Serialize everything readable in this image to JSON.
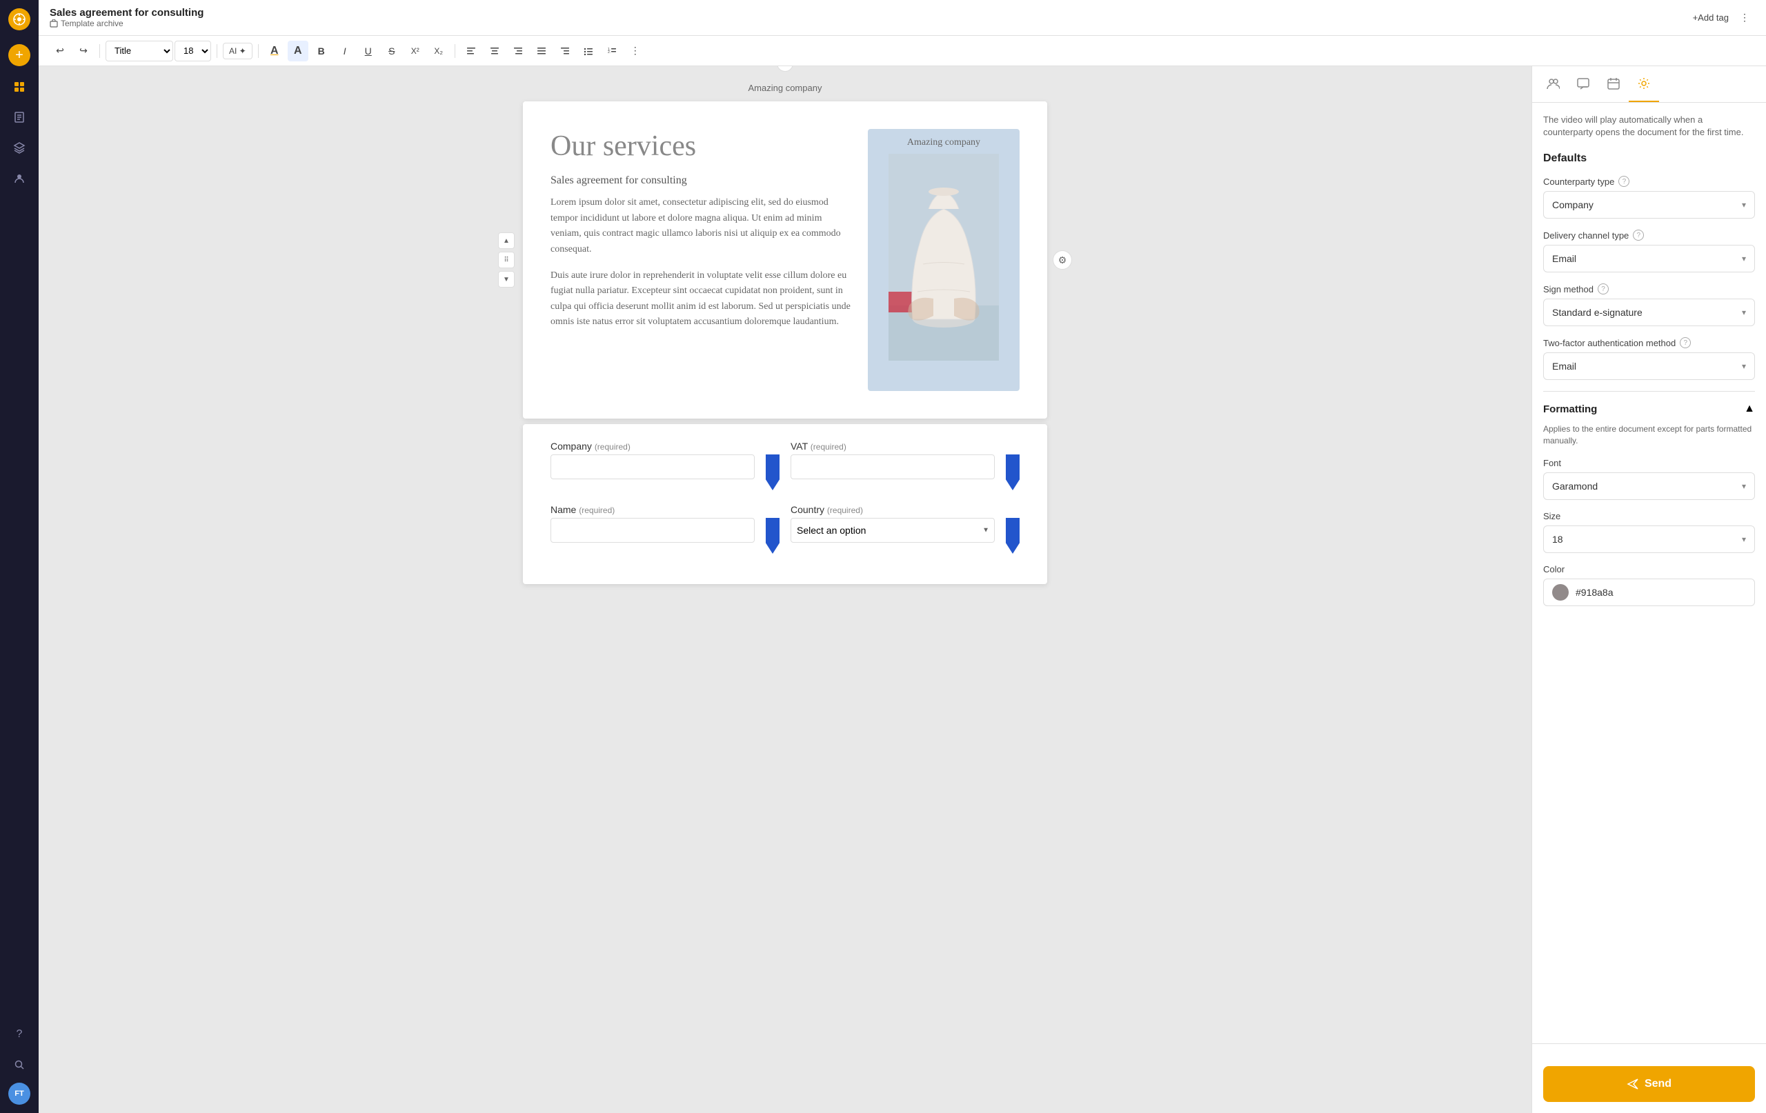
{
  "app": {
    "logo": "⊕",
    "avatar": "FT"
  },
  "sidebar": {
    "items": [
      {
        "name": "settings-icon",
        "icon": "⚙",
        "active": false
      },
      {
        "name": "grid-icon",
        "icon": "⊞",
        "active": false
      },
      {
        "name": "layers-icon",
        "icon": "≡",
        "active": false
      },
      {
        "name": "user-icon",
        "icon": "👤",
        "active": false
      }
    ]
  },
  "topbar": {
    "doc_title": "Sales agreement for consulting",
    "template_archive": "Template archive",
    "add_tag": "+Add tag"
  },
  "toolbar": {
    "style_label": "Title",
    "font_size": "18",
    "undo_label": "↩",
    "redo_label": "↪",
    "ai_label": "AI ✦",
    "bold": "B",
    "italic": "I",
    "underline": "U",
    "strikethrough": "S",
    "superscript": "X²",
    "subscript": "X₂"
  },
  "document": {
    "company": "Amazing company",
    "heading": "Our services",
    "subtitle": "Sales agreement for consulting",
    "body1": "Lorem ipsum dolor sit amet, consectetur adipiscing elit, sed do eiusmod tempor incididunt ut labore et dolore magna aliqua. Ut enim ad minim veniam, quis contract magic ullamco laboris nisi ut aliquip ex ea commodo consequat.",
    "body2": "Duis aute irure dolor in reprehenderit in voluptate velit esse cillum dolore eu fugiat nulla pariatur. Excepteur sint occaecat cupidatat non proident, sunt in culpa qui officia deserunt mollit anim id est laborum. Sed ut perspiciatis unde omnis iste natus error sit voluptatem accusantium doloremque laudantium.",
    "image_label": "Amazing company"
  },
  "fields": {
    "company_label": "Company",
    "company_required": "(required)",
    "vat_label": "VAT",
    "vat_required": "(required)",
    "name_label": "Name",
    "name_required": "(required)",
    "country_label": "Country",
    "country_required": "(required)",
    "country_placeholder": "Select an option"
  },
  "right_panel": {
    "tabs": [
      {
        "name": "collaborators",
        "icon": "👥"
      },
      {
        "name": "chat",
        "icon": "💬"
      },
      {
        "name": "calendar",
        "icon": "📅"
      },
      {
        "name": "settings",
        "icon": "⚙",
        "active": true
      }
    ],
    "video_note": "The video will play automatically when a counterparty opens the document for the first time.",
    "defaults_title": "Defaults",
    "counterparty_type_label": "Counterparty type",
    "counterparty_type_value": "Company",
    "delivery_channel_label": "Delivery channel type",
    "delivery_channel_value": "Email",
    "sign_method_label": "Sign method",
    "sign_method_value": "Standard e-signature",
    "two_factor_label": "Two-factor authentication method",
    "two_factor_value": "Email",
    "formatting_title": "Formatting",
    "formatting_note": "Applies to the entire document except for parts formatted manually.",
    "font_label": "Font",
    "font_value": "Garamond",
    "size_label": "Size",
    "size_value": "18",
    "color_label": "Color",
    "color_value": "#918a8a",
    "color_hex": "#918a8a",
    "send_label": "Send"
  }
}
